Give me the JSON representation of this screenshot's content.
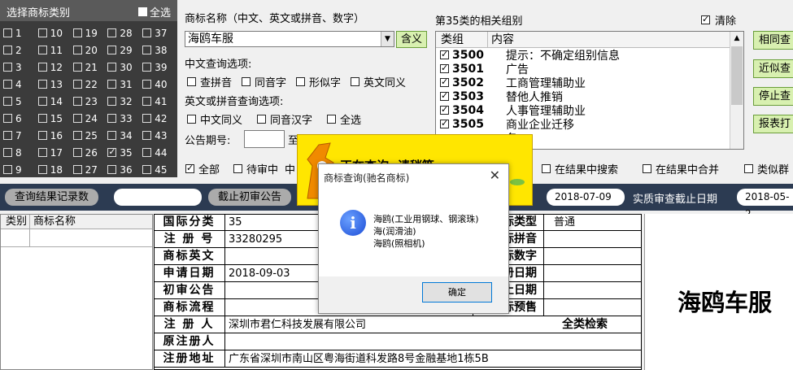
{
  "categories": {
    "title": "选择商标类别",
    "select_all": "全选",
    "items": [
      {
        "n": "1",
        "checked": false
      },
      {
        "n": "10",
        "checked": false
      },
      {
        "n": "19",
        "checked": false
      },
      {
        "n": "28",
        "checked": false
      },
      {
        "n": "37",
        "checked": false
      },
      {
        "n": "2",
        "checked": false
      },
      {
        "n": "11",
        "checked": false
      },
      {
        "n": "20",
        "checked": false
      },
      {
        "n": "29",
        "checked": false
      },
      {
        "n": "38",
        "checked": false
      },
      {
        "n": "3",
        "checked": false
      },
      {
        "n": "12",
        "checked": false
      },
      {
        "n": "21",
        "checked": false
      },
      {
        "n": "30",
        "checked": false
      },
      {
        "n": "39",
        "checked": false
      },
      {
        "n": "4",
        "checked": false
      },
      {
        "n": "13",
        "checked": false
      },
      {
        "n": "22",
        "checked": false
      },
      {
        "n": "31",
        "checked": false
      },
      {
        "n": "40",
        "checked": false
      },
      {
        "n": "5",
        "checked": false
      },
      {
        "n": "14",
        "checked": false
      },
      {
        "n": "23",
        "checked": false
      },
      {
        "n": "32",
        "checked": false
      },
      {
        "n": "41",
        "checked": false
      },
      {
        "n": "6",
        "checked": false
      },
      {
        "n": "15",
        "checked": false
      },
      {
        "n": "24",
        "checked": false
      },
      {
        "n": "33",
        "checked": false
      },
      {
        "n": "42",
        "checked": false
      },
      {
        "n": "7",
        "checked": false
      },
      {
        "n": "16",
        "checked": false
      },
      {
        "n": "25",
        "checked": false
      },
      {
        "n": "34",
        "checked": false
      },
      {
        "n": "43",
        "checked": false
      },
      {
        "n": "8",
        "checked": false
      },
      {
        "n": "17",
        "checked": false
      },
      {
        "n": "26",
        "checked": false
      },
      {
        "n": "35",
        "checked": true
      },
      {
        "n": "44",
        "checked": false
      },
      {
        "n": "9",
        "checked": false
      },
      {
        "n": "18",
        "checked": false
      },
      {
        "n": "27",
        "checked": false
      },
      {
        "n": "36",
        "checked": false
      },
      {
        "n": "45",
        "checked": false
      }
    ]
  },
  "search": {
    "name_label": "商标名称（中文、英文或拼音、数字）",
    "name_value": "海鸥车服",
    "meaning_button": "含义",
    "zh_options_title": "中文查询选项:",
    "zh_options": [
      "查拼音",
      "同音字",
      "形似字",
      "英文同义"
    ],
    "en_options_title": "英文或拼音查询选项:",
    "en_options": [
      "中文同义",
      "同音汉字",
      "全选"
    ],
    "issue_label": "公告期号:",
    "issue_to": "至"
  },
  "groups": {
    "title": "第35类的相关组别",
    "clear_label": "清除",
    "header_group": "类组",
    "header_content": "内容",
    "rows": [
      {
        "code": "3500",
        "text": "提示：不确定组别信息"
      },
      {
        "code": "3501",
        "text": "广告"
      },
      {
        "code": "3502",
        "text": "工商管理辅助业"
      },
      {
        "code": "3503",
        "text": "替他人推销"
      },
      {
        "code": "3504",
        "text": "人事管理辅助业"
      },
      {
        "code": "3505",
        "text": "商业企业迁移"
      },
      {
        "code": "",
        "text": "务"
      }
    ]
  },
  "right_buttons": [
    "相同查",
    "近似查",
    "停止查",
    "报表打"
  ],
  "filters": {
    "all": "全部",
    "pending": "待审中",
    "partial": "中",
    "search_in_results": "在结果中搜索",
    "merge_in_results": "在结果中合并",
    "similar": "类似群"
  },
  "bar": {
    "record_count_label": "查询结果记录数",
    "deadline_label": "截止初审公告",
    "date1": "2018-07-09",
    "actual_deadline_label": "实质审查截止日期",
    "date2": "2018-05-2"
  },
  "results": {
    "header_cat": "类别",
    "header_name": "商标名称"
  },
  "detail": {
    "intl_class_label": "国际分类",
    "intl_class_value": "35",
    "reg_no_label": "注 册 号",
    "reg_no_value": "33280295",
    "english_label": "商标英文",
    "apply_date_label": "申请日期",
    "apply_date_value": "2018-09-03",
    "initial_label": "初审公告",
    "process_label": "商标流程",
    "registrant_label": "注 册 人",
    "registrant_value": "深圳市君仁科技发展有限公司",
    "orig_registrant_label": "原注册人",
    "address_label": "注册地址",
    "address_value": "广东省深圳市南山区粤海街道科发路8号金融基地1栋5B",
    "type_label": "标类型",
    "type_value": "普通",
    "pinyin_label": "标拼音",
    "digit_label": "标数字",
    "r_date1_label": "册日期",
    "r_date2_label": "止日期",
    "preview_label": "标预售",
    "all_class_search": "全类检索"
  },
  "preview": {
    "text": "海鸥车服"
  },
  "banner": {
    "text": "正在查询, 请稍等..."
  },
  "dialog": {
    "title": "商标查询(驰名商标)",
    "lines": [
      "海鸥(工业用钢球、钢滚珠)",
      "海(润滑油)",
      "海鸥(照相机)"
    ],
    "ok": "确定"
  }
}
